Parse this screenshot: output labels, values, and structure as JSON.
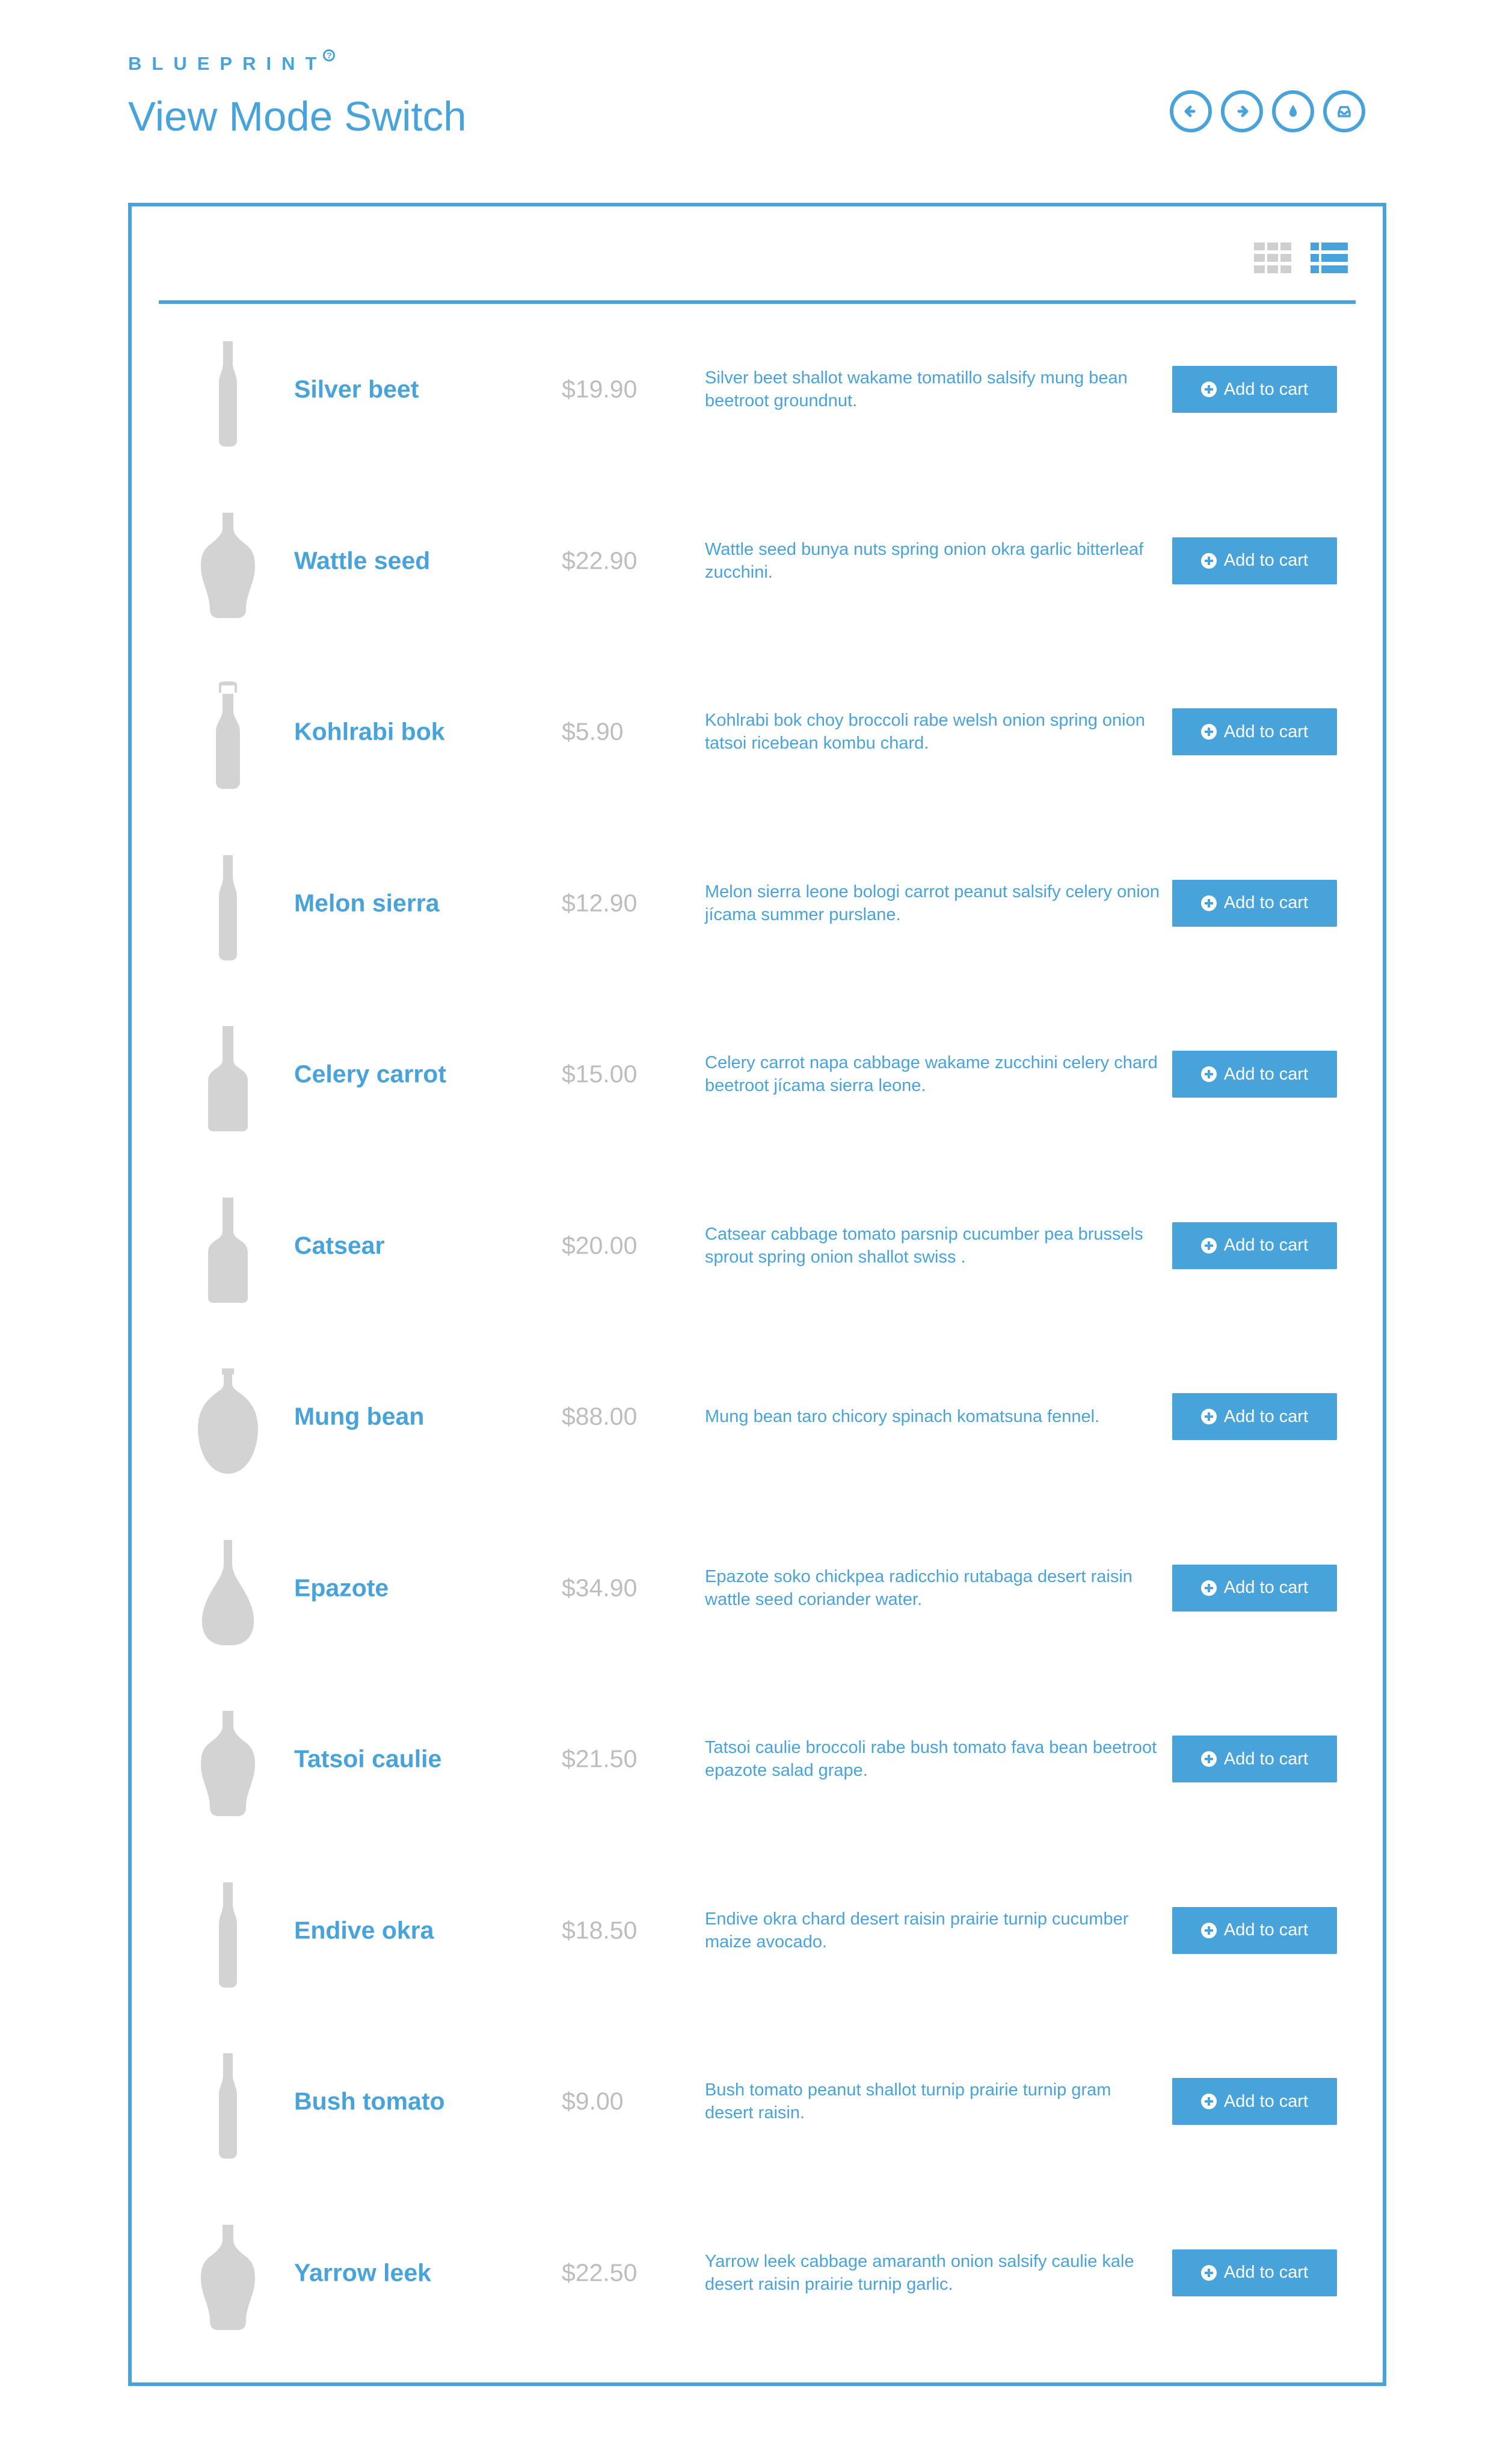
{
  "header": {
    "brand": "BLUEPRINT",
    "brand_mark": "?",
    "title": "View Mode Switch"
  },
  "top_nav": [
    {
      "name": "previous-icon"
    },
    {
      "name": "next-icon"
    },
    {
      "name": "drop-icon"
    },
    {
      "name": "archive-icon"
    }
  ],
  "view_modes": [
    {
      "name": "grid-view-icon",
      "active": false
    },
    {
      "name": "list-view-icon",
      "active": true
    }
  ],
  "colors": {
    "accent": "#47a3da",
    "muted": "#bdbdbd",
    "silhouette": "#d3d3d3"
  },
  "cart_label": "Add to cart",
  "products": [
    {
      "name": "Silver beet",
      "price": "$19.90",
      "description": "Silver beet shallot wakame tomatillo salsify mung bean beetroot groundnut.",
      "bottle": "tall-slim"
    },
    {
      "name": "Wattle seed",
      "price": "$22.90",
      "description": "Wattle seed bunya nuts spring onion okra garlic bitterleaf zucchini.",
      "bottle": "wide-shoulder"
    },
    {
      "name": "Kohlrabi bok",
      "price": "$5.90",
      "description": "Kohlrabi bok choy broccoli rabe welsh onion spring onion tatsoi ricebean kombu chard.",
      "bottle": "swing-top"
    },
    {
      "name": "Melon sierra",
      "price": "$12.90",
      "description": "Melon sierra leone bologi carrot peanut salsify celery onion jícama summer purslane.",
      "bottle": "tall-slim"
    },
    {
      "name": "Celery carrot",
      "price": "$15.00",
      "description": "Celery carrot napa cabbage wakame zucchini celery chard beetroot jícama sierra leone.",
      "bottle": "square"
    },
    {
      "name": "Catsear",
      "price": "$20.00",
      "description": "Catsear cabbage tomato parsnip cucumber pea brussels sprout spring onion shallot swiss .",
      "bottle": "square"
    },
    {
      "name": "Mung bean",
      "price": "$88.00",
      "description": "Mung bean taro chicory spinach komatsuna fennel.",
      "bottle": "round"
    },
    {
      "name": "Epazote",
      "price": "$34.90",
      "description": "Epazote soko chickpea radicchio rutabaga desert raisin wattle seed coriander water.",
      "bottle": "teardrop"
    },
    {
      "name": "Tatsoi caulie",
      "price": "$21.50",
      "description": "Tatsoi caulie broccoli rabe bush tomato fava bean beetroot epazote salad grape.",
      "bottle": "wide-shoulder"
    },
    {
      "name": "Endive okra",
      "price": "$18.50",
      "description": "Endive okra chard desert raisin prairie turnip cucumber maize avocado.",
      "bottle": "tall-slim"
    },
    {
      "name": "Bush tomato",
      "price": "$9.00",
      "description": "Bush tomato peanut shallot turnip prairie turnip gram desert raisin.",
      "bottle": "tall-slim"
    },
    {
      "name": "Yarrow leek",
      "price": "$22.50",
      "description": "Yarrow leek cabbage amaranth onion salsify caulie kale desert raisin prairie turnip garlic.",
      "bottle": "wide-shoulder"
    }
  ]
}
